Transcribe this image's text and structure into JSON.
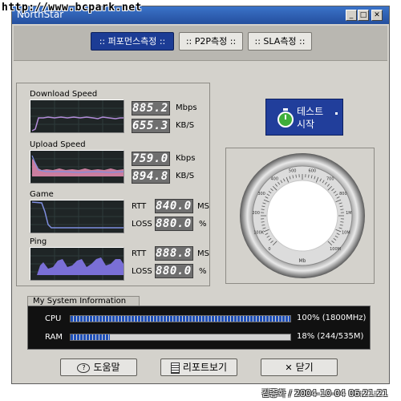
{
  "watermark": "http://www.bcpark.net",
  "window": {
    "title": "NorthStar",
    "min_icon": "minimize-icon",
    "max_icon": "maximize-icon",
    "close_icon": "close-icon"
  },
  "tabs": [
    {
      "label": ":: 퍼포먼스측정 ::",
      "active": true
    },
    {
      "label": ":: P2P측정 ::",
      "active": false
    },
    {
      "label": ":: SLA측정 ::",
      "active": false
    }
  ],
  "download": {
    "label": "Download Speed",
    "value1": "885.2",
    "unit1": "Mbps",
    "value2": "655.3",
    "unit2": "KB/S"
  },
  "upload": {
    "label": "Upload Speed",
    "value1": "759.0",
    "unit1": "Kbps",
    "value2": "894.8",
    "unit2": "KB/S"
  },
  "game": {
    "label": "Game",
    "rtt_label": "RTT",
    "rtt_value": "840.0",
    "rtt_unit": "MS",
    "loss_label": "LOSS",
    "loss_value": "880.0",
    "loss_unit": "%"
  },
  "ping": {
    "label": "Ping",
    "rtt_label": "RTT",
    "rtt_value": "888.8",
    "rtt_unit": "MS",
    "loss_label": "LOSS",
    "loss_value": "880.0",
    "loss_unit": "%"
  },
  "start_button": {
    "line1": "테스트",
    "line2": "시작",
    "icon": "stopwatch-icon"
  },
  "gauge": {
    "ticks": [
      "0",
      "100K",
      "200",
      "300",
      "400",
      "500",
      "600",
      "700",
      "800",
      "1M",
      "10M",
      "100M"
    ],
    "center_label": "Mb"
  },
  "system_info": {
    "title": "My System Information",
    "cpu_label": "CPU",
    "cpu_percent": 100,
    "cpu_text": "100% (1800MHz)",
    "ram_label": "RAM",
    "ram_percent": 18,
    "ram_text": "18% (244/535M)"
  },
  "buttons": {
    "help": "도움말",
    "help_icon": "help-icon",
    "report": "리포트보기",
    "report_icon": "report-icon",
    "close": "닫기",
    "close_icon": "close-icon"
  },
  "credit": "김종화 / 2004-10-04 06:21:21",
  "colors": {
    "tab_active": "#1c3c95",
    "graph_bg": "#1f2526",
    "graph_line_download": "#b38cd9",
    "graph_line_upload": "#e98db5",
    "graph_line_game": "#7f8fe0",
    "graph_area_ping": "#7a6fd6",
    "bar_fill": "#1e4fb8"
  }
}
